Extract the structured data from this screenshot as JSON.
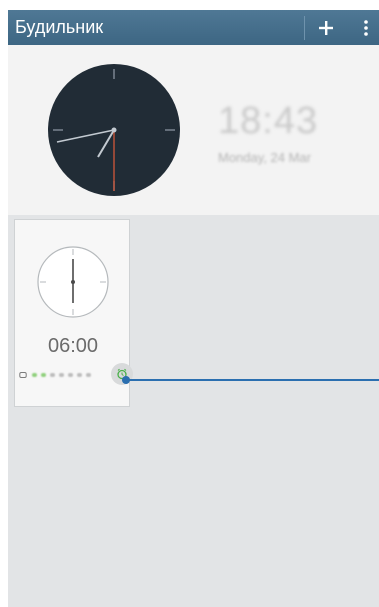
{
  "header": {
    "title": "Будильник",
    "add_icon": "plus-icon",
    "menu_icon": "more-vertical-icon"
  },
  "world_clock": {
    "time": "18:43",
    "date": "Monday, 24 Mar"
  },
  "alarms": [
    {
      "time": "06:00",
      "enabled": true,
      "repeat_icon": "repeat-icon",
      "toggle_icon": "alarm-clock-icon"
    }
  ],
  "colors": {
    "action_bar": "#466f8c",
    "accent_line": "#2b6fb0",
    "active_day": "#8fd07c"
  }
}
